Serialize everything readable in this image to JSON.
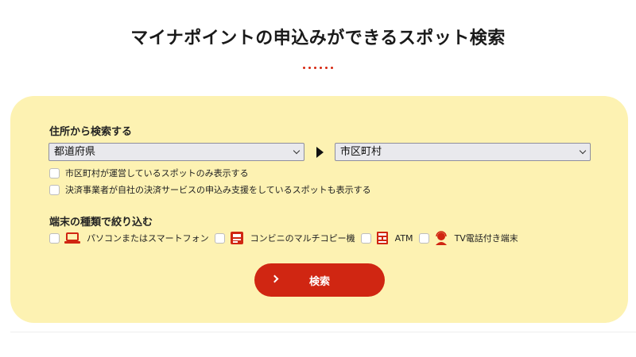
{
  "page": {
    "title": "マイナポイントの申込みができるスポット検索"
  },
  "address_search": {
    "label": "住所から検索する",
    "prefecture_select": {
      "value": "都道府県"
    },
    "city_select": {
      "value": "市区町村"
    },
    "options": [
      "市区町村が運営しているスポットのみ表示する",
      "決済事業者が自社の決済サービスの申込み支援をしているスポットも表示する"
    ]
  },
  "device_filter": {
    "label": "端末の種類で絞り込む",
    "items": [
      {
        "label": "パソコンまたはスマートフォン",
        "icon": "laptop-icon"
      },
      {
        "label": "コンビニのマルチコピー機",
        "icon": "multi-copy-machine-icon"
      },
      {
        "label": "ATM",
        "icon": "atm-icon"
      },
      {
        "label": "TV電話付き端末",
        "icon": "video-call-operator-icon"
      }
    ]
  },
  "search_button": {
    "label": "検索"
  },
  "colors": {
    "accent": "#d02612",
    "panel": "#fdf2b2"
  }
}
